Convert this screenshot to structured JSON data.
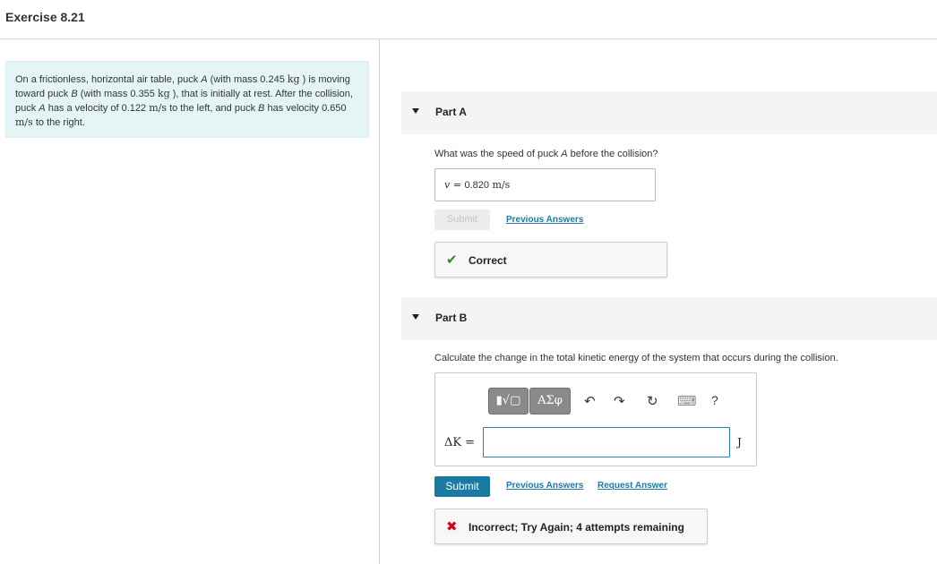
{
  "header": {
    "title": "Exercise 8.21"
  },
  "problem": {
    "t1": "On a frictionless, horizontal air table, puck ",
    "puckA": "A",
    "t2": " (with mass 0.245 ",
    "kg1": "kg",
    "t3": " ) is moving toward puck ",
    "puckB": "B",
    "t4": " (with mass 0.355 ",
    "kg2": "kg",
    "t5": " ), that is initially at rest. After the collision, puck ",
    "puckA2": "A",
    "t6": " has a velocity of 0.122 ",
    "ms1": "m/s",
    "t7": " to the left, and puck ",
    "puckB2": "B",
    "t8": " has velocity 0.650 ",
    "ms2": "m/s",
    "t9": " to the right."
  },
  "partA": {
    "label": "Part A",
    "question_pre": "What was the speed of puck ",
    "question_var": "A",
    "question_post": " before the collision?",
    "answer_var": "v",
    "answer_eq": " = ",
    "answer_value": "0.820",
    "answer_unit": "m/s",
    "submit_label": "Submit",
    "previous_answers": "Previous Answers",
    "feedback": "Correct"
  },
  "partB": {
    "label": "Part B",
    "question": "Calculate the change in the total kinetic energy of the system that occurs during the collision.",
    "toolbar": {
      "templates_glyph": "▮√▢",
      "symbols_glyph": "ΑΣφ",
      "undo_glyph": "↶",
      "redo_glyph": "↷",
      "reset_glyph": "↻",
      "keyboard_glyph": "⌨",
      "help_glyph": "?"
    },
    "eq_label": "ΔK =",
    "input_value": "",
    "unit": "J",
    "submit_label": "Submit",
    "previous_answers": "Previous Answers",
    "request_answer": "Request Answer",
    "feedback": "Incorrect; Try Again; 4 attempts remaining"
  },
  "colors": {
    "correct": "#2e8b2e",
    "incorrect": "#d0021b",
    "accent": "#1a7aa2"
  }
}
